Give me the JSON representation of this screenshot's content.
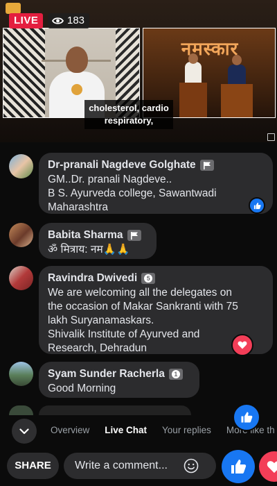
{
  "video": {
    "live_label": "LIVE",
    "viewer_count": "183",
    "caption_line1": "cholesterol, cardio",
    "caption_line2": "respiratory,",
    "banner_text": "नमस्कार"
  },
  "comments": [
    {
      "name": "Dr-pranali Nagdeve Golghate",
      "badge": "",
      "lines": [
        "GM..Dr. pranali Nagdeve..",
        "B S. Ayurveda college, Sawantwadi",
        "Maharashtra"
      ],
      "reaction": "like"
    },
    {
      "name": "Babita Sharma",
      "badge": "",
      "lines": [
        "ॐ मित्राय: नम🙏🙏"
      ],
      "reaction": ""
    },
    {
      "name": "Ravindra Dwivedi",
      "badge": "5",
      "lines": [
        "We are welcoming all the delegates on",
        "the occasion of Makar Sankranti with 75",
        "lakh Suryanamaskars.",
        "Shivalik Institute of Ayurved and",
        "Research, Dehradun"
      ],
      "reaction": "love"
    },
    {
      "name": "Syam Sunder Racherla",
      "badge": "1",
      "lines": [
        "Good Morning"
      ],
      "reaction": ""
    }
  ],
  "tabs": [
    {
      "label": "Overview",
      "active": false
    },
    {
      "label": "Live Chat",
      "active": true
    },
    {
      "label": "Your replies",
      "active": false
    },
    {
      "label": "More like th",
      "active": false
    }
  ],
  "composer": {
    "share_label": "SHARE",
    "placeholder": "Write a comment..."
  },
  "colors": {
    "live_red": "#e41e3f",
    "like_blue": "#1877f2",
    "love_red": "#f33e58",
    "bubble": "#2c2c2e"
  }
}
